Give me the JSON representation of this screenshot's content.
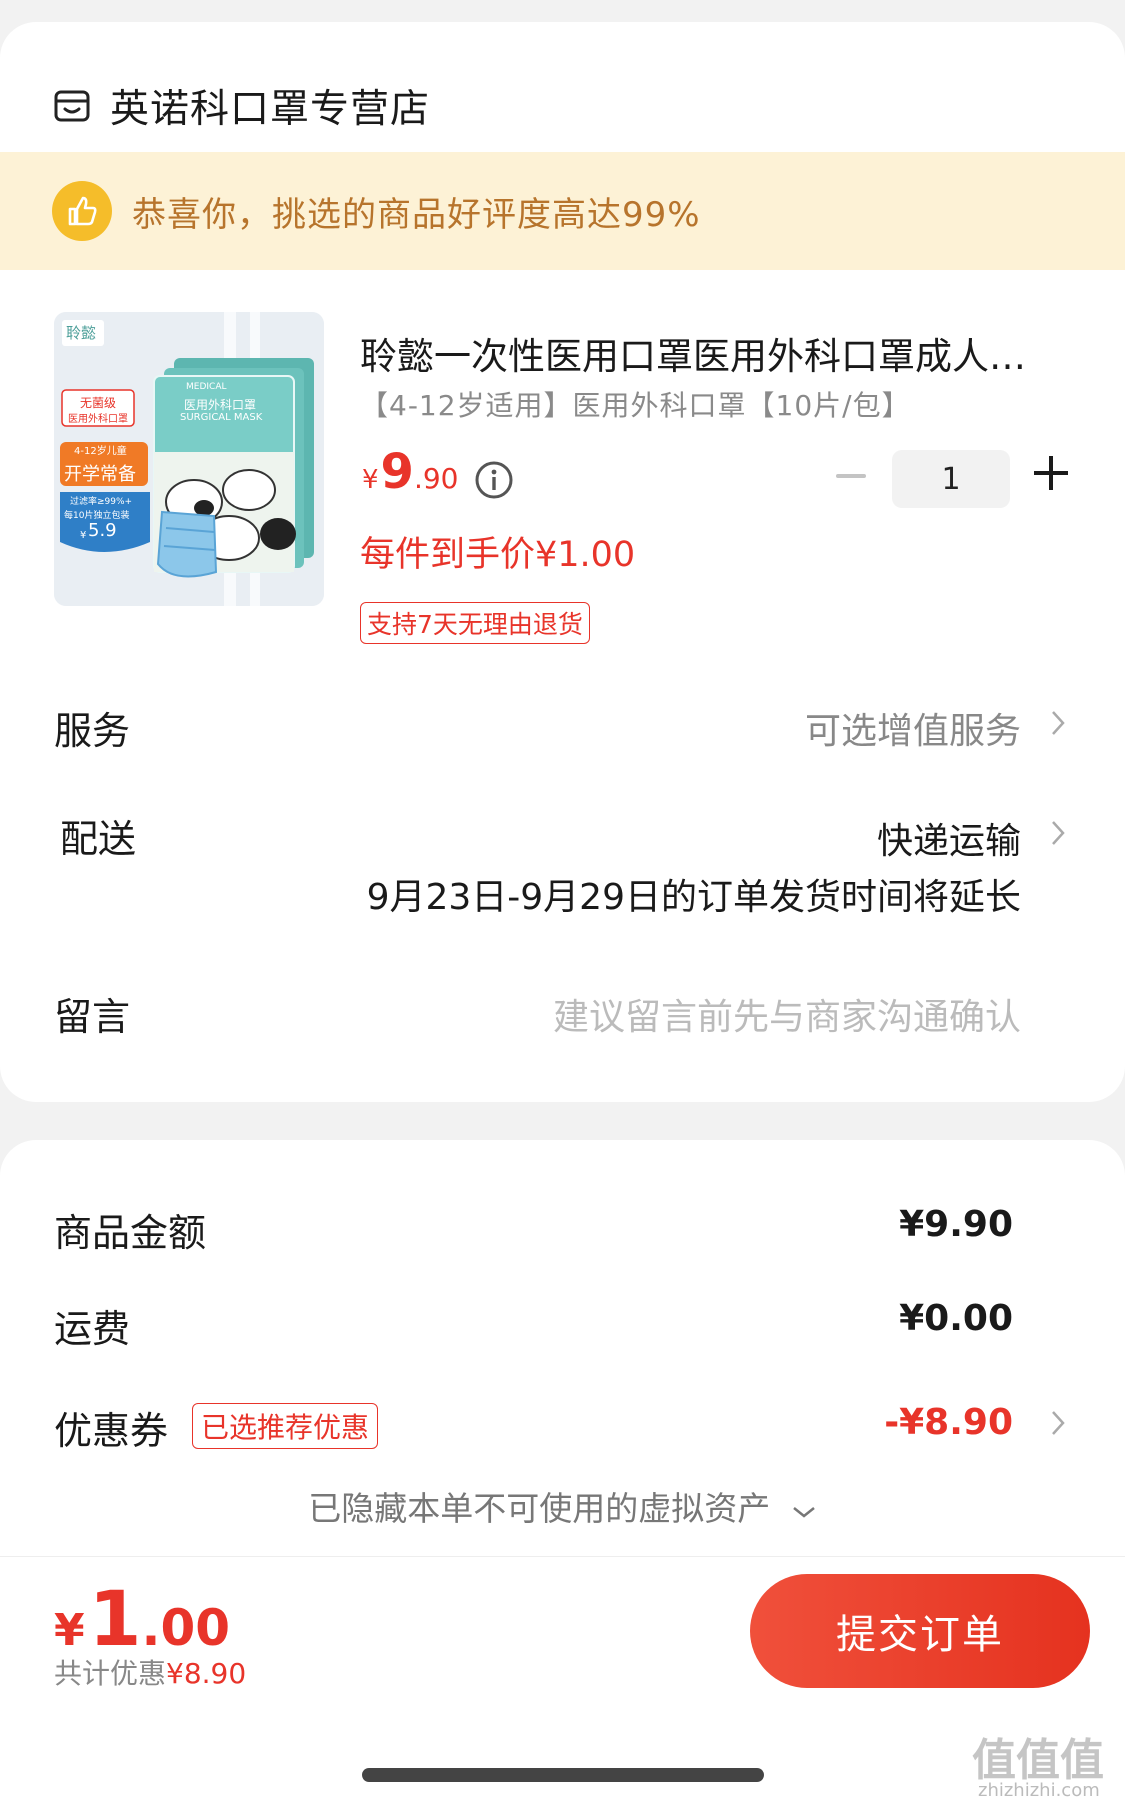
{
  "store": {
    "icon": "store-icon",
    "name": "英诺科口罩专营店"
  },
  "banner": {
    "icon": "thumbs-up-icon",
    "text": "恭喜你，挑选的商品好评度高达99%"
  },
  "product": {
    "image_alt": "product-image",
    "image_brand": "聆懿",
    "image_tag_1": "无菌级",
    "image_tag_1b": "医用外科口罩",
    "image_tag_2": "4-12岁儿童",
    "image_tag_3": "开学常备",
    "image_tag_4": "过滤率≥99%+",
    "image_tag_5": "每10片独立包装",
    "image_price_yen": "¥",
    "image_price": "5.9",
    "image_pack_title": "医用外科口罩",
    "image_pack_en": "SURGICAL MASK",
    "image_pack_medical": "MEDICAL",
    "title": "聆懿一次性医用口罩医用外科口罩成人儿童三层防护",
    "spec": "【4-12岁适用】医用外科口罩【10片/包】",
    "price_yen": "¥",
    "price_int": "9",
    "price_dec": ".90",
    "quantity": "1",
    "net_price": "每件到手价¥1.00",
    "return_policy": "支持7天无理由退货"
  },
  "rows": {
    "service_label": "服务",
    "service_value": "可选增值服务",
    "delivery_label": "配送",
    "delivery_value": "快递运输",
    "delivery_note": "9月23日-9月29日的订单发货时间将延长",
    "message_label": "留言",
    "message_placeholder": "建议留言前先与商家沟通确认"
  },
  "summary": {
    "goods_label": "商品金额",
    "goods_value": "¥9.90",
    "shipping_label": "运费",
    "shipping_value": "¥0.00",
    "coupon_label": "优惠券",
    "coupon_tag": "已选推荐优惠",
    "coupon_value": "-¥8.90",
    "hidden_assets": "已隐藏本单不可使用的虚拟资产"
  },
  "footer": {
    "total_yen": "¥",
    "total_int": "1",
    "total_dec": ".00",
    "saving_label": "共计优惠",
    "saving_value": "¥8.90",
    "submit_label": "提交订单"
  },
  "watermark": {
    "main": "值值值",
    "sub": "zhizhizhi.com"
  },
  "colors": {
    "accent_red": "#e8342a",
    "banner_bg": "#fdf2d6",
    "banner_text": "#b7742c"
  }
}
